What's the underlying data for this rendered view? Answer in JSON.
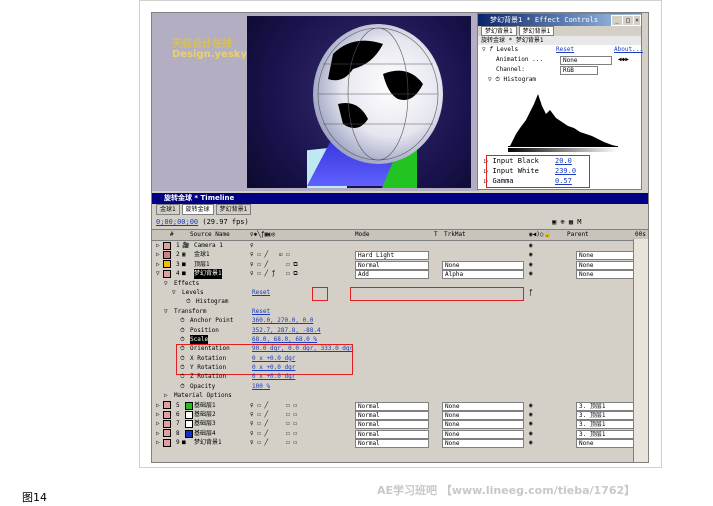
{
  "figure_caption": "图14",
  "watermark": "AE学习班吧 【www.lineeg.com/tieba/1762】",
  "composition": {
    "logo_line1": "天极设计在线",
    "logo_line2": "Design.yesky.com"
  },
  "effect_controls": {
    "title": "梦幻背景1 * Effect Controls",
    "tabs": [
      "梦幻背景1",
      "梦幻背景1"
    ],
    "subheader": "旋转金球 * 梦幻背景1",
    "effect_name": "Levels",
    "reset": "Reset",
    "about": "About...",
    "animation_label": "Animation ...",
    "animation_value": "None",
    "channel_label": "Channel:",
    "channel_value": "RGB",
    "histogram_label": "Histogram",
    "params": [
      {
        "label": "Input Black",
        "value": "20.0"
      },
      {
        "label": "Input White",
        "value": "239.0"
      },
      {
        "label": "Gamma",
        "value": "0.57"
      }
    ]
  },
  "timeline": {
    "title": "旋转金球 * Timeline",
    "tabs": [
      "金球1",
      "旋转金球",
      "梦幻背景1"
    ],
    "timecode": "0;00;00;00",
    "fps": "(29.97 fps)",
    "headers": {
      "num": "#",
      "source": "Source Name",
      "mode": "Mode",
      "t": "T",
      "trkmat": "TrkMat",
      "parent": "Parent",
      "time_start": "00s"
    },
    "layers": [
      {
        "num": "1",
        "name": "Camera 1",
        "color": "#e0a0a0",
        "mode": "",
        "trkmat": "",
        "parent": ""
      },
      {
        "num": "2",
        "name": "金球1",
        "color": "#d08080",
        "mode": "Hard Light",
        "trkmat": "",
        "parent": "None"
      },
      {
        "num": "3",
        "name": "顶层1",
        "color": "#f0c000",
        "mode": "Normal",
        "trkmat": "None",
        "parent": "None"
      },
      {
        "num": "4",
        "name": "梦幻背景1",
        "color": "#e0a0a0",
        "mode": "Add",
        "trkmat": "Alpha",
        "parent": "None"
      }
    ],
    "effects_label": "Effects",
    "levels_label": "Levels",
    "levels_reset": "Reset",
    "histogram_label": "Histogram",
    "transform_label": "Transform",
    "transform_reset": "Reset",
    "props": [
      {
        "label": "Anchor Point",
        "value": "360.0, 270.0, 0.0"
      },
      {
        "label": "Position",
        "value": "352.7, 287.8, -88.4"
      },
      {
        "label": "Scale",
        "value": "68.0, 68.0, 68.0 %"
      },
      {
        "label": "Orientation",
        "value": "90.0 dgr, 0.0 dgr, 333.0 dgr"
      },
      {
        "label": "X Rotation",
        "value": "0 x +0.0 dgr"
      },
      {
        "label": "Y Rotation",
        "value": "0 x +0.0 dgr"
      },
      {
        "label": "Z Rotation",
        "value": "0 x +0.0 dgr"
      },
      {
        "label": "Opacity",
        "value": "100 %"
      }
    ],
    "material_label": "Material Options",
    "bottom_layers": [
      {
        "num": "5",
        "name": "基础层1",
        "color": "#20c020",
        "mode": "Normal",
        "trkmat": "None",
        "parent": "3. 顶层1"
      },
      {
        "num": "6",
        "name": "基础层2",
        "color": "#ffffff",
        "mode": "Normal",
        "trkmat": "None",
        "parent": "3. 顶层1"
      },
      {
        "num": "7",
        "name": "基础层3",
        "color": "#ffffff",
        "mode": "Normal",
        "trkmat": "None",
        "parent": "3. 顶层1"
      },
      {
        "num": "8",
        "name": "基础层4",
        "color": "#1030c0",
        "mode": "Normal",
        "trkmat": "None",
        "parent": "3. 顶层1"
      },
      {
        "num": "9",
        "name": "梦幻背景1",
        "color": "#e0a0a0",
        "mode": "Normal",
        "trkmat": "None",
        "parent": "None"
      }
    ]
  }
}
